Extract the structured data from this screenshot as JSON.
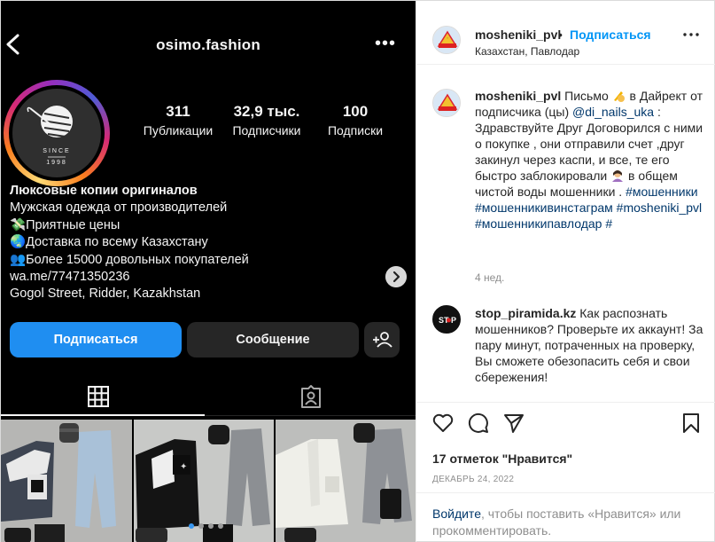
{
  "screenshot": {
    "username": "osimo.fashion",
    "stats": [
      {
        "value": "311",
        "label": "Публикации"
      },
      {
        "value": "32,9 тыс.",
        "label": "Подписчики"
      },
      {
        "value": "100",
        "label": "Подписки"
      }
    ],
    "avatar_text": {
      "since": "SINCE",
      "year": "1998"
    },
    "bio": {
      "title": "Люксовые копии оригиналов",
      "lines": [
        "Мужская одежда от производителей",
        "Приятные цены",
        "Доставка по всему Казахстану",
        "Более 15000 довольных покупателей"
      ],
      "link": "wa.me/77471350236",
      "address": "Gogol Street, Ridder, Kazakhstan"
    },
    "buttons": {
      "subscribe": "Подписаться",
      "message": "Сообщение"
    }
  },
  "post": {
    "author": "mosheniki_pvl",
    "dot": "•",
    "follow": "Подписаться",
    "location": "Казахстан, Павлодар",
    "caption": {
      "username": "mosheniki_pvl",
      "t1": "Письмо",
      "t2": "в Дайрект от подписчика (цы)",
      "mention": "@di_nails_uka",
      "t3": ": Здравствуйте Друг Договорился с ними о покупке , они отправили счет ,друг закинул через каспи, и все, те его быстро заблокировали",
      "t4": "в общем чистой воды мошенники .",
      "h1": "#мошенники",
      "h2": "#мошенникивинстаграм",
      "h3": "#mosheniki_pvl",
      "h4": "#мошенникипавлодар",
      "h5": "#",
      "time": "4 нед."
    },
    "comment": {
      "username": "stop_piramida.kz",
      "text": "Как распознать мошенников? Проверьте их аккаунт! За пару минут, потраченных на проверку, Вы сможете обезопасить себя и свои сбережения!"
    },
    "likes": "17 отметок \"Нравится\"",
    "date": "ДЕКАБРЬ 24, 2022",
    "login": {
      "link": "Войдите",
      "text": ", чтобы поставить «Нравится» или прокомментировать."
    }
  },
  "icons": [
    "back-arrow-icon",
    "more-options-icon",
    "chevron-right-icon",
    "add-person-icon",
    "grid-icon",
    "tagged-icon",
    "heart-icon",
    "comment-icon",
    "share-icon",
    "bookmark-icon",
    "ellipsis-icon"
  ]
}
